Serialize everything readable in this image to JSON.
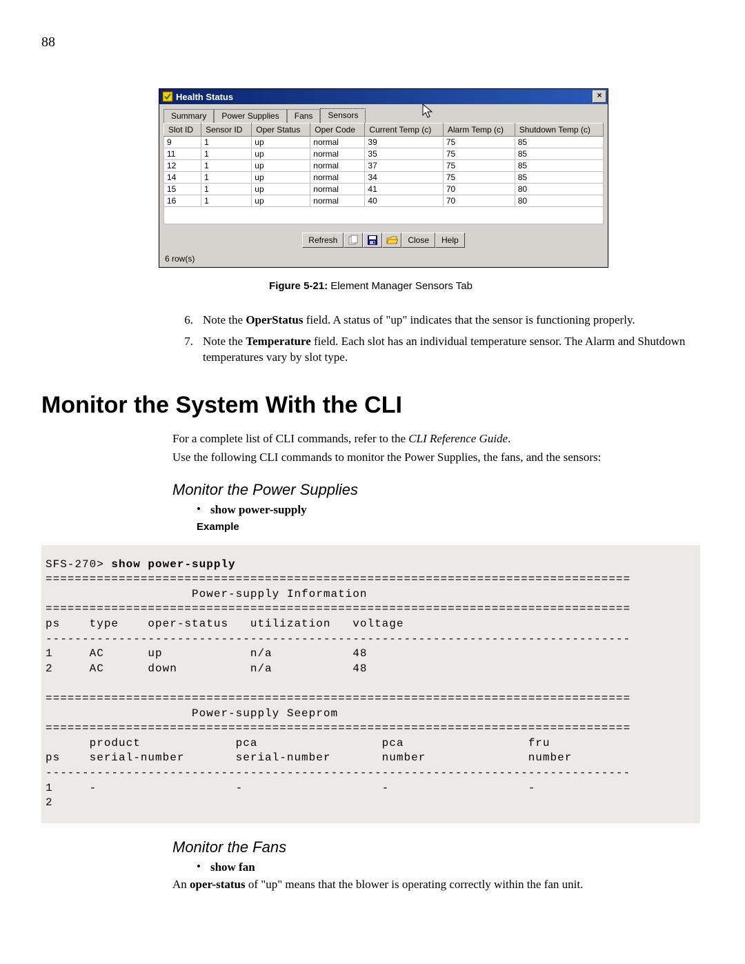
{
  "page_number": "88",
  "window": {
    "title": "Health Status",
    "close_glyph": "×",
    "tabs": {
      "summary": "Summary",
      "power_supplies": "Power Supplies",
      "fans": "Fans",
      "sensors": "Sensors"
    },
    "headers": {
      "slot_id": "Slot ID",
      "sensor_id": "Sensor ID",
      "oper_status": "Oper Status",
      "oper_code": "Oper Code",
      "current_temp": "Current Temp (c)",
      "alarm_temp": "Alarm Temp (c)",
      "shutdown_temp": "Shutdown Temp (c)"
    },
    "rows": [
      {
        "slot_id": "9",
        "sensor_id": "1",
        "oper_status": "up",
        "oper_code": "normal",
        "current_temp": "39",
        "alarm_temp": "75",
        "shutdown_temp": "85"
      },
      {
        "slot_id": "11",
        "sensor_id": "1",
        "oper_status": "up",
        "oper_code": "normal",
        "current_temp": "35",
        "alarm_temp": "75",
        "shutdown_temp": "85"
      },
      {
        "slot_id": "12",
        "sensor_id": "1",
        "oper_status": "up",
        "oper_code": "normal",
        "current_temp": "37",
        "alarm_temp": "75",
        "shutdown_temp": "85"
      },
      {
        "slot_id": "14",
        "sensor_id": "1",
        "oper_status": "up",
        "oper_code": "normal",
        "current_temp": "34",
        "alarm_temp": "75",
        "shutdown_temp": "85"
      },
      {
        "slot_id": "15",
        "sensor_id": "1",
        "oper_status": "up",
        "oper_code": "normal",
        "current_temp": "41",
        "alarm_temp": "70",
        "shutdown_temp": "80"
      },
      {
        "slot_id": "16",
        "sensor_id": "1",
        "oper_status": "up",
        "oper_code": "normal",
        "current_temp": "40",
        "alarm_temp": "70",
        "shutdown_temp": "80"
      }
    ],
    "buttons": {
      "refresh": "Refresh",
      "close": "Close",
      "help": "Help"
    },
    "status": "6 row(s)"
  },
  "figure": {
    "label": "Figure 5-21:",
    "caption": " Element Manager Sensors Tab"
  },
  "list": {
    "n6": "6.",
    "t6_a": "Note the ",
    "t6_b": "OperStatus",
    "t6_c": " field. A status of \"up\" indicates that the sensor is functioning properly.",
    "n7": "7.",
    "t7_a": "Note the ",
    "t7_b": "Temperature",
    "t7_c": " field. Each slot has an individual temperature sensor. The Alarm and Shutdown temperatures vary by slot type."
  },
  "h1": "Monitor the System With the CLI",
  "intro1_a": "For a complete list of CLI commands, refer to the ",
  "intro1_b": "CLI Reference Guide",
  "intro1_c": ".",
  "intro2": "Use the following CLI commands to monitor the Power Supplies, the fans, and the sensors:",
  "sub_ps": "Monitor the Power Supplies",
  "bullet_ps": "show power-supply",
  "example_label": "Example",
  "cli": {
    "prompt": "SFS-270> ",
    "cmd": "show power-supply",
    "body": "\n================================================================================\n                    Power-supply Information\n================================================================================\nps    type    oper-status   utilization   voltage\n--------------------------------------------------------------------------------\n1     AC      up            n/a           48\n2     AC      down          n/a           48\n\n================================================================================\n                    Power-supply Seeprom\n================================================================================\n      product             pca                 pca                 fru\nps    serial-number       serial-number       number              number\n--------------------------------------------------------------------------------\n1     -                   -                   -                   -\n2"
  },
  "sub_fans": "Monitor the Fans",
  "bullet_fan": "show fan",
  "fan_para_a": "An ",
  "fan_para_b": "oper-status",
  "fan_para_c": " of \"up\" means that the blower is operating correctly within the fan unit."
}
